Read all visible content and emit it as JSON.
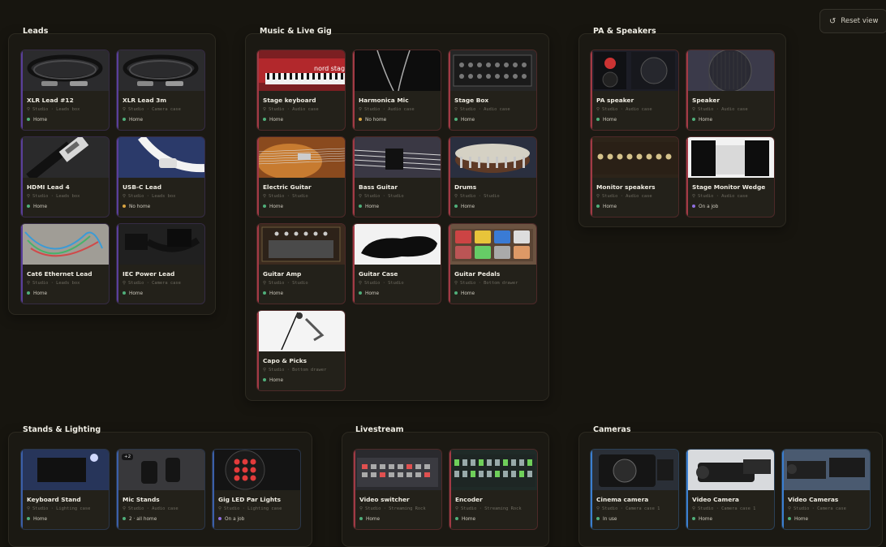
{
  "reset_label": "Reset view",
  "status_colors": {
    "Home": "#4fae7a",
    "No home": "#d9a441",
    "On a job": "#8f6fe0",
    "In use": "#4fae7a",
    "2 · all home": "#4fae7a"
  },
  "groups": [
    {
      "title": "Leads",
      "cards": [
        {
          "name": "XLR Lead #12",
          "loc": "Studio · Leads box",
          "status": "Home",
          "accent": "#5a3f9a",
          "thumb": "cable-coil"
        },
        {
          "name": "XLR Lead 3m",
          "loc": "Studio · Camera case",
          "status": "Home",
          "accent": "#5a3f9a",
          "thumb": "cable-coil"
        },
        {
          "name": "HDMI Lead 4",
          "loc": "Studio · Leads box",
          "status": "Home",
          "accent": "#5a3f9a",
          "thumb": "hdmi"
        },
        {
          "name": "USB-C Lead",
          "loc": "Studio · Leads box",
          "status": "No home",
          "accent": "#5a3f9a",
          "thumb": "usbc"
        },
        {
          "name": "Cat6 Ethernet Lead",
          "loc": "Studio · Leads box",
          "status": "Home",
          "accent": "#5a3f9a",
          "thumb": "ethernet"
        },
        {
          "name": "IEC Power Lead",
          "loc": "Studio · Camera case",
          "status": "Home",
          "accent": "#5a3f9a",
          "thumb": "iec"
        }
      ]
    },
    {
      "title": "Music & Live Gig",
      "cards": [
        {
          "name": "Stage keyboard",
          "loc": "Studio · Audio case",
          "status": "Home",
          "accent": "#a23a45",
          "thumb": "keyboard"
        },
        {
          "name": "Harmonica Mic",
          "loc": "Studio · Audio case",
          "status": "No home",
          "accent": "#a23a45",
          "thumb": "mic"
        },
        {
          "name": "Stage Box",
          "loc": "Studio · Audio case",
          "status": "Home",
          "accent": "#a23a45",
          "thumb": "stagebox"
        },
        {
          "name": "Electric Guitar",
          "loc": "Studio · Studio",
          "status": "Home",
          "accent": "#a23a45",
          "thumb": "guitar"
        },
        {
          "name": "Bass Guitar",
          "loc": "Studio · Studio",
          "status": "Home",
          "accent": "#a23a45",
          "thumb": "bass"
        },
        {
          "name": "Drums",
          "loc": "Studio · Studio",
          "status": "Home",
          "accent": "#a23a45",
          "thumb": "drums"
        },
        {
          "name": "Guitar Amp",
          "loc": "Studio · Studio",
          "status": "Home",
          "accent": "#a23a45",
          "thumb": "amp"
        },
        {
          "name": "Guitar Case",
          "loc": "Studio · Studio",
          "status": "Home",
          "accent": "#a23a45",
          "thumb": "case"
        },
        {
          "name": "Guitar Pedals",
          "loc": "Studio · Bottom drawer",
          "status": "Home",
          "accent": "#a23a45",
          "thumb": "pedals"
        },
        {
          "name": "Capo & Picks",
          "loc": "Studio · Bottom drawer",
          "status": "Home",
          "accent": "#a23a45",
          "thumb": "capo"
        }
      ]
    },
    {
      "title": "PA & Speakers",
      "cards": [
        {
          "name": "PA speaker",
          "loc": "Studio · Audio case",
          "status": "Home",
          "accent": "#a23a45",
          "thumb": "paspeaker"
        },
        {
          "name": "Speaker",
          "loc": "Studio · Audio case",
          "status": "Home",
          "accent": "#a23a45",
          "thumb": "speakergrill"
        },
        {
          "name": "Monitor speakers",
          "loc": "Studio · Audio case",
          "status": "Home",
          "accent": "#a23a45",
          "thumb": "monitor"
        },
        {
          "name": "Stage Monitor Wedge",
          "loc": "Studio · Audio case",
          "status": "On a job",
          "accent": "#a23a45",
          "thumb": "wedge"
        }
      ]
    },
    {
      "title": "Stands & Lighting",
      "cards": [
        {
          "name": "Keyboard Stand",
          "loc": "Studio · Lighting case",
          "status": "Home",
          "accent": "#3b5fa8",
          "thumb": "stage"
        },
        {
          "name": "Mic Stands",
          "loc": "Studio · Audio case",
          "status": "2 · all home",
          "accent": "#3b5fa8",
          "thumb": "micstands",
          "badge": "+2"
        },
        {
          "name": "Gig LED Par Lights",
          "loc": "Studio · Lighting case",
          "status": "On a job",
          "accent": "#3b5fa8",
          "thumb": "ledpar"
        }
      ]
    },
    {
      "title": "Livestream",
      "cards": [
        {
          "name": "Video switcher",
          "loc": "Studio · Streaming Rock",
          "status": "Home",
          "accent": "#a23a45",
          "thumb": "switcher"
        },
        {
          "name": "Encoder",
          "loc": "Studio · Streaming Rock",
          "status": "Home",
          "accent": "#a23a45",
          "thumb": "encoder"
        }
      ]
    },
    {
      "title": "Cameras",
      "cards": [
        {
          "name": "Cinema camera",
          "loc": "Studio · Camera case 1",
          "status": "In use",
          "accent": "#3b7fd0",
          "thumb": "cinecam"
        },
        {
          "name": "Video Camera",
          "loc": "Studio · Camera case 1",
          "status": "Home",
          "accent": "#3b7fd0",
          "thumb": "videocam"
        },
        {
          "name": "Video Cameras",
          "loc": "Studio · Camera case",
          "status": "Home",
          "accent": "#3b7fd0",
          "thumb": "videocams"
        }
      ]
    }
  ]
}
